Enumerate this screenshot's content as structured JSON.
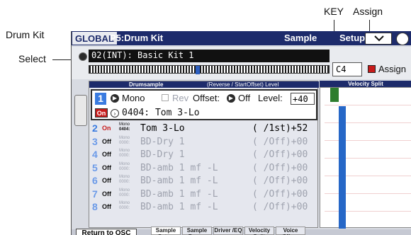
{
  "callouts": {
    "key": "KEY",
    "assign": "Assign",
    "drumkit": "Drum Kit",
    "select": "Select"
  },
  "titlebar": {
    "mode": "GLOBAL",
    "page": "P5:Drum Kit",
    "tab": "Sample",
    "tab2": "Setup"
  },
  "kit": {
    "name": "02(INT): Basic Kit 1",
    "key": "C4",
    "assign_label": "Assign"
  },
  "panel": {
    "col_drumsample": "Drumsample",
    "col_reverse": "(Reverse / StartOffset) Level",
    "velocity_split": "Velocity Split"
  },
  "selected": {
    "index": "1",
    "mode": "Mono",
    "rev_label": "Rev",
    "offset_label": "Offset:",
    "offset_value": "Off",
    "level_label": "Level:",
    "level_value": "+40",
    "on_label": "On",
    "sample": "0404: Tom 3-Lo"
  },
  "rows": [
    {
      "num": "2",
      "state": "On",
      "mono": "Mono",
      "code": "0404:",
      "name": "Tom 3-Lo",
      "value": "( /1st)+52"
    },
    {
      "num": "3",
      "state": "Off",
      "mono": "Mono",
      "code": "0000:",
      "name": "BD-Dry 1",
      "value": "( /Off)+00"
    },
    {
      "num": "4",
      "state": "Off",
      "mono": "Mono",
      "code": "0000:",
      "name": "BD-Dry 1",
      "value": "( /Off)+00"
    },
    {
      "num": "5",
      "state": "Off",
      "mono": "Mono",
      "code": "0000:",
      "name": "BD-amb 1 mf -L",
      "value": "( /Off)+00"
    },
    {
      "num": "6",
      "state": "Off",
      "mono": "Mono",
      "code": "0000:",
      "name": "BD-amb 1 mf -L",
      "value": "( /Off)+00"
    },
    {
      "num": "7",
      "state": "Off",
      "mono": "Mono",
      "code": "0000:",
      "name": "BD-amb 1 mf -L",
      "value": "( /Off)+00"
    },
    {
      "num": "8",
      "state": "Off",
      "mono": "Mono",
      "code": "0000:",
      "name": "BD-amb 1 mf -L",
      "value": "( /Off)+00"
    }
  ],
  "bottom": {
    "return": "Return to OSC",
    "tabs": [
      "Sample Setup",
      "Sample Param",
      "Driver /EQ",
      "Velocity Split",
      "Voice /Mixer"
    ]
  },
  "colors": {
    "title_bg": "#1d2b6b",
    "accent_blue": "#3a7be0",
    "on_red": "#c71b1b",
    "vel_green": "#2e7d2e",
    "vel_blue": "#2667c7"
  }
}
